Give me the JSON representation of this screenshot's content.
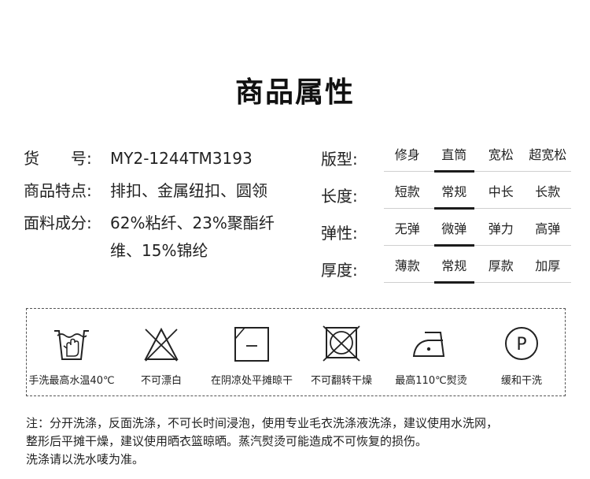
{
  "title": "商品属性",
  "info": [
    {
      "label": "货　　号:",
      "value": "MY2-1244TM3193"
    },
    {
      "label": "商品特点:",
      "value": "排扣、金属纽扣、圆领"
    },
    {
      "label": "面料成分:",
      "value": "62%粘纤、23%聚酯纤维、15%锦纶"
    }
  ],
  "attributes": [
    {
      "label": "版型:",
      "options": [
        "修身",
        "直筒",
        "宽松",
        "超宽松"
      ],
      "selected": 1
    },
    {
      "label": "长度:",
      "options": [
        "短款",
        "常规",
        "中长",
        "长款"
      ],
      "selected": 1
    },
    {
      "label": "弹性:",
      "options": [
        "无弹",
        "微弹",
        "弹力",
        "高弹"
      ],
      "selected": 1
    },
    {
      "label": "厚度:",
      "options": [
        "薄款",
        "常规",
        "厚款",
        "加厚"
      ],
      "selected": 1
    }
  ],
  "care": [
    {
      "icon": "hand-wash-40-icon",
      "label": "手洗最高水温40℃"
    },
    {
      "icon": "do-not-bleach-icon",
      "label": "不可漂白"
    },
    {
      "icon": "dry-flat-in-shade-icon",
      "label": "在阴凉处平摊晾干"
    },
    {
      "icon": "do-not-tumble-dry-icon",
      "label": "不可翻转干燥"
    },
    {
      "icon": "iron-110-icon",
      "label": "最高110℃熨烫"
    },
    {
      "icon": "dry-clean-p-icon",
      "label": "缓和干洗",
      "icon_text": "P"
    }
  ],
  "notes": [
    "注：分开洗涤，反面洗涤，不可长时间浸泡，使用专业毛衣洗涤液洗涤，建议使用水洗网，",
    "整形后平摊干燥，建议使用晒衣篮晾晒。蒸汽熨烫可能造成不可恢复的损伤。",
    "洗涤请以洗水唛为准。"
  ]
}
